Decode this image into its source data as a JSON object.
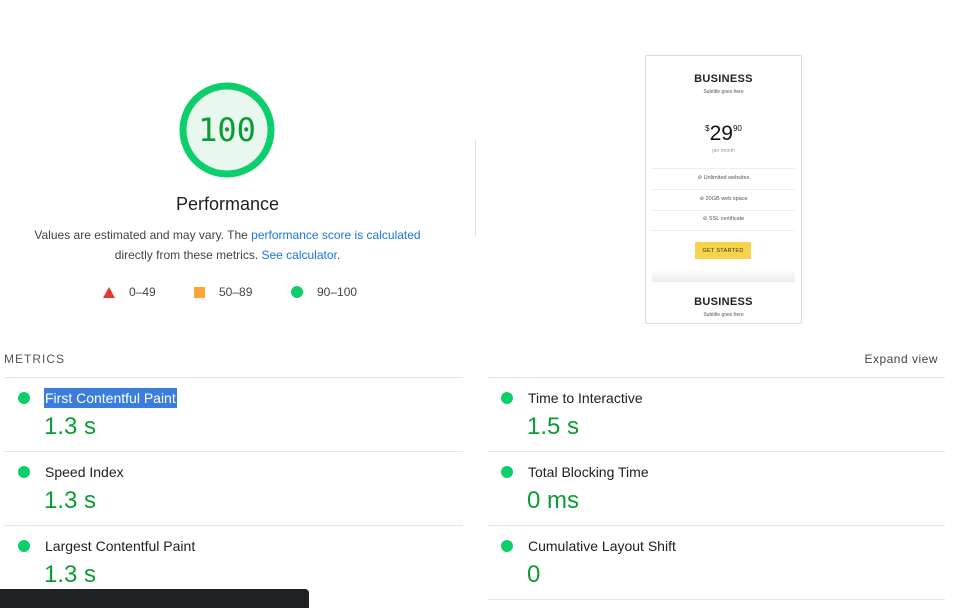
{
  "performance": {
    "score": "100",
    "score_fraction": 1.0,
    "title": "Performance",
    "desc_prefix": "Values are estimated and may vary. The ",
    "desc_link1": "performance score is calculated",
    "desc_middle": "directly from these metrics. ",
    "desc_link2": "See calculator",
    "desc_suffix": "."
  },
  "legend": [
    {
      "shape": "triangle",
      "label": "0–49",
      "color": "#e53935"
    },
    {
      "shape": "square",
      "label": "50–89",
      "color": "#fba736"
    },
    {
      "shape": "circle",
      "label": "90–100",
      "color": "#0cce6b"
    }
  ],
  "screenshot": {
    "plan_name": "BUSINESS",
    "subtitle": "Subtitle goes here",
    "price_currency": "$",
    "price_main": "29",
    "price_cents": "90",
    "period": "per month",
    "features": [
      "⊘ Unlimited websites",
      "⊘ 20GB web space",
      "⊘ SSL certificate"
    ],
    "cta_label": "GET STARTED",
    "plan_name_2": "BUSINESS",
    "subtitle_2": "Subtitle goes here"
  },
  "metrics_header": {
    "title": "METRICS",
    "expand_label": "Expand view"
  },
  "metrics": [
    {
      "name": "First Contentful Paint",
      "value": "1.3 s"
    },
    {
      "name": "Time to Interactive",
      "value": "1.5 s"
    },
    {
      "name": "Speed Index",
      "value": "1.3 s"
    },
    {
      "name": "Total Blocking Time",
      "value": "0 ms"
    },
    {
      "name": "Largest Contentful Paint",
      "value": "1.3 s"
    },
    {
      "name": "Cumulative Layout Shift",
      "value": "0"
    }
  ],
  "colors": {
    "pass": "#0cce6b",
    "pass_text": "#0c9b35",
    "link": "#1a73e8",
    "selection": "#3b7ddd"
  }
}
